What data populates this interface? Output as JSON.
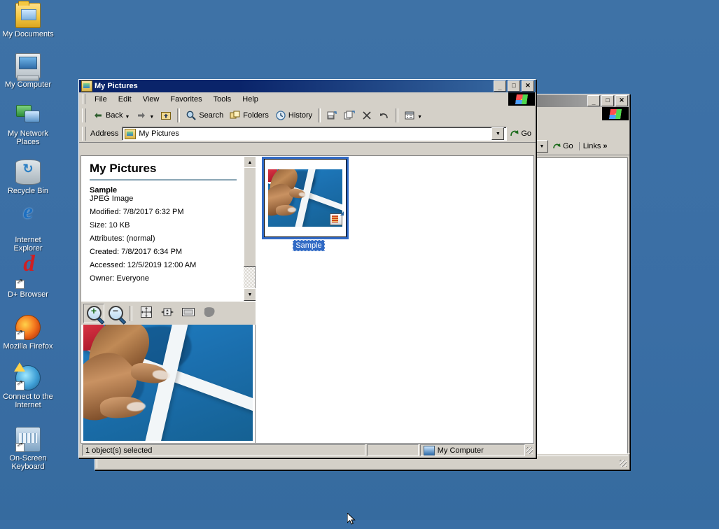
{
  "desktop": {
    "background_color": "#3a6ea5",
    "icons": [
      {
        "label": "My Documents",
        "icon": "folder-documents-icon",
        "shortcut": false
      },
      {
        "label": "My Computer",
        "icon": "computer-icon",
        "shortcut": false
      },
      {
        "label": "My Network Places",
        "icon": "network-places-icon",
        "shortcut": false
      },
      {
        "label": "Recycle Bin",
        "icon": "recycle-bin-icon",
        "shortcut": false
      },
      {
        "label": "Internet Explorer",
        "icon": "internet-explorer-icon",
        "shortcut": false
      },
      {
        "label": "D+ Browser",
        "icon": "d-plus-browser-icon",
        "shortcut": true
      },
      {
        "label": "Mozilla Firefox",
        "icon": "firefox-icon",
        "shortcut": true
      },
      {
        "label": "Connect to the Internet",
        "icon": "connect-internet-icon",
        "shortcut": true
      },
      {
        "label": "On-Screen Keyboard",
        "icon": "on-screen-keyboard-icon",
        "shortcut": true
      }
    ]
  },
  "explorer": {
    "title": "My Pictures",
    "title_icon": "my-pictures-folder-icon",
    "window_buttons": {
      "minimize": "_",
      "maximize": "□",
      "close": "✕"
    },
    "menu": [
      "File",
      "Edit",
      "View",
      "Favorites",
      "Tools",
      "Help"
    ],
    "toolbar": [
      {
        "label": "Back",
        "icon": "back-arrow-icon",
        "has_dropdown": true
      },
      {
        "label": "",
        "icon": "forward-arrow-icon",
        "has_dropdown": true
      },
      {
        "label": "",
        "icon": "up-folder-icon",
        "has_dropdown": false
      },
      {
        "label": "Search",
        "icon": "search-icon",
        "has_dropdown": false
      },
      {
        "label": "Folders",
        "icon": "folders-icon",
        "has_dropdown": false
      },
      {
        "label": "History",
        "icon": "history-icon",
        "has_dropdown": false
      },
      {
        "label": "",
        "icon": "move-to-icon",
        "has_dropdown": false
      },
      {
        "label": "",
        "icon": "copy-to-icon",
        "has_dropdown": false
      },
      {
        "label": "",
        "icon": "delete-icon",
        "has_dropdown": false
      },
      {
        "label": "",
        "icon": "undo-icon",
        "has_dropdown": false
      },
      {
        "label": "",
        "icon": "views-icon",
        "has_dropdown": true
      }
    ],
    "address": {
      "label": "Address",
      "value": "My Pictures",
      "icon": "my-pictures-folder-icon",
      "go_label": "Go",
      "go_icon": "go-arrow-icon"
    },
    "info_pane": {
      "heading": "My Pictures",
      "file_name": "Sample",
      "file_type": "JPEG Image",
      "details": [
        "Modified: 7/8/2017 6:32 PM",
        "Size: 10 KB",
        "Attributes: (normal)",
        "Created: 7/8/2017 6:34 PM",
        "Accessed: 12/5/2019 12:00 AM",
        "Owner: Everyone"
      ]
    },
    "preview_toolbar": [
      {
        "icon": "zoom-in-icon",
        "active": true
      },
      {
        "icon": "zoom-out-icon",
        "active": false
      },
      {
        "icon": "actual-size-icon",
        "active": false
      },
      {
        "icon": "best-fit-icon",
        "active": false
      },
      {
        "icon": "full-screen-icon",
        "active": false
      },
      {
        "icon": "rotate-icon",
        "active": false
      }
    ],
    "items": [
      {
        "label": "Sample",
        "selected": true,
        "overlay_icon": "jpeg-shortcut-badge-icon"
      }
    ],
    "status_bar": {
      "left": "1 object(s) selected",
      "middle": "",
      "right": "My Computer",
      "right_icon": "my-computer-small-icon"
    }
  },
  "background_window": {
    "title": "",
    "window_buttons": {
      "minimize": "_",
      "maximize": "□",
      "close": "✕"
    },
    "address": {
      "go_label": "Go",
      "go_icon": "go-arrow-icon"
    },
    "links_label": "Links",
    "links_chevron": "»"
  }
}
